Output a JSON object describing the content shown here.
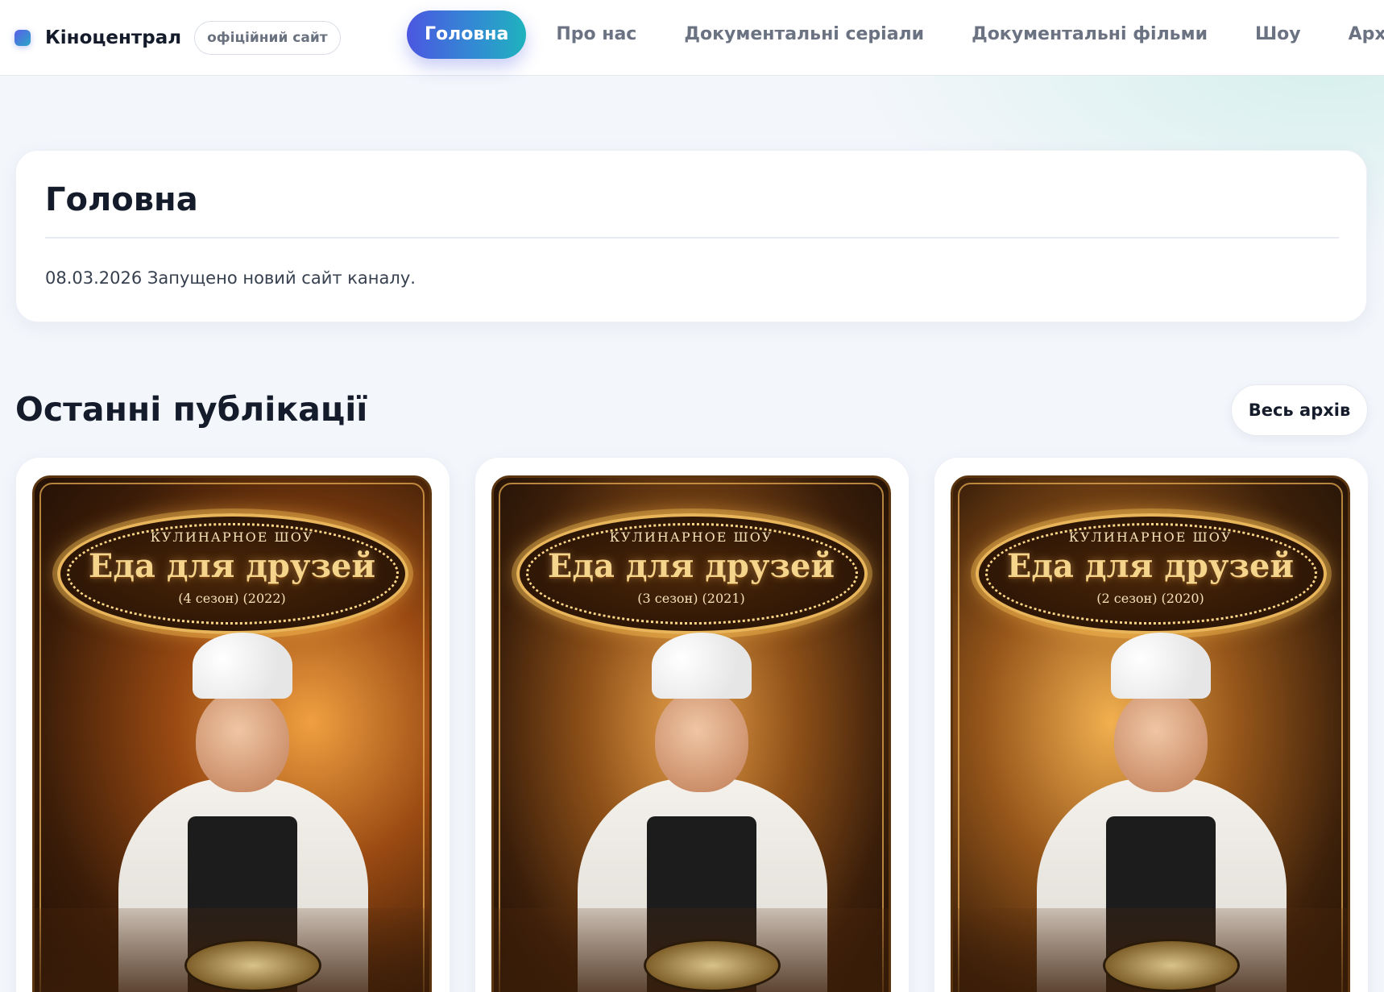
{
  "header": {
    "brand_name": "Кіноцентрал",
    "brand_badge": "офіційний сайт",
    "nav": [
      {
        "label": "Головна",
        "active": true
      },
      {
        "label": "Про нас",
        "active": false
      },
      {
        "label": "Документальні серіали",
        "active": false
      },
      {
        "label": "Документальні фільми",
        "active": false
      },
      {
        "label": "Шоу",
        "active": false
      },
      {
        "label": "Архів",
        "active": false
      }
    ]
  },
  "intro": {
    "title": "Головна",
    "text": "08.03.2026 Запущено новий сайт каналу."
  },
  "latest": {
    "title": "Останні публікації",
    "archive_button": "Весь архів",
    "cards": [
      {
        "poster_kicker": "КУЛИНАРНОЕ ШОУ",
        "poster_title": "Еда для друзей",
        "poster_sub": "(4 сезон) (2022)"
      },
      {
        "poster_kicker": "КУЛИНАРНОЕ ШОУ",
        "poster_title": "Еда для друзей",
        "poster_sub": "(3 сезон) (2021)"
      },
      {
        "poster_kicker": "КУЛИНАРНОЕ ШОУ",
        "poster_title": "Еда для друзей",
        "poster_sub": "(2 сезон) (2020)"
      }
    ]
  },
  "colors": {
    "accent_start": "#4b57e0",
    "accent_end": "#1fb3bd",
    "background": "#f3f6fb",
    "text_dark": "#141b2b"
  }
}
